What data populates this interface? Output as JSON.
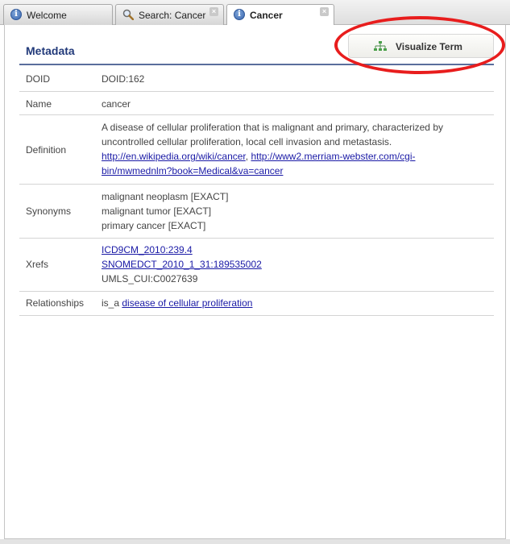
{
  "tabs": [
    {
      "label": "Welcome",
      "icon": "info-icon",
      "active": false,
      "closable": false
    },
    {
      "label": "Search: Cancer",
      "icon": "search-icon",
      "active": false,
      "closable": true
    },
    {
      "label": "Cancer",
      "icon": "info-icon",
      "active": true,
      "closable": true
    }
  ],
  "section": {
    "title": "Metadata"
  },
  "visualize_button": {
    "label": "Visualize Term",
    "icon": "hierarchy-icon"
  },
  "annotation": {
    "color": "#e81d1d"
  },
  "rows": {
    "doid": {
      "key": "DOID",
      "value": "DOID:162"
    },
    "name": {
      "key": "Name",
      "value": "cancer"
    },
    "definition": {
      "key": "Definition",
      "line1": "A disease of cellular proliferation that is malignant and primary, characterized by",
      "line2": "uncontrolled cellular proliferation, local cell invasion and metastasis.",
      "link1": "http://en.wikipedia.org/wiki/cancer",
      "sep": ",",
      "link2_part1": "http://www2.merriam-webster.com/cgi-",
      "link2_part2": "bin/mwmednlm?book=Medical&va=cancer"
    },
    "synonyms": {
      "key": "Synonyms",
      "items": [
        "malignant neoplasm [EXACT]",
        "malignant tumor [EXACT]",
        "primary cancer [EXACT]"
      ]
    },
    "xrefs": {
      "key": "Xrefs",
      "link1": "ICD9CM_2010:239.4",
      "link2": "SNOMEDCT_2010_1_31:189535002",
      "plain": "UMLS_CUI:C0027639"
    },
    "relationships": {
      "key": "Relationships",
      "prefix": "is_a",
      "link": "disease of cellular proliferation"
    }
  },
  "colors": {
    "heading": "#223a7a",
    "link": "#1a1aa6"
  }
}
